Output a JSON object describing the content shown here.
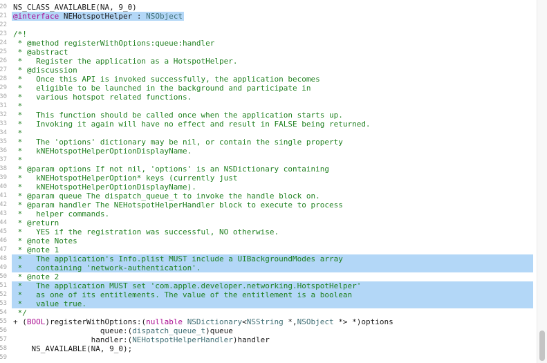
{
  "editor": {
    "lines": [
      {
        "n": "20",
        "hl": "",
        "segs": [
          [
            "pl",
            "NS_CLASS_AVAILABLE(NA, 9_0)"
          ]
        ]
      },
      {
        "n": "21",
        "hl": "partial",
        "segs": [
          [
            "kw",
            "@interface"
          ],
          [
            "pl",
            " NEHotspotHelper : "
          ],
          [
            "ty",
            "NSObject"
          ]
        ]
      },
      {
        "n": "22",
        "hl": "",
        "segs": []
      },
      {
        "n": "23",
        "hl": "",
        "segs": [
          [
            "c",
            "/*!"
          ]
        ]
      },
      {
        "n": "24",
        "hl": "",
        "segs": [
          [
            "c",
            " * @method registerWithOptions:queue:handler"
          ]
        ]
      },
      {
        "n": "25",
        "hl": "",
        "segs": [
          [
            "c",
            " * @abstract"
          ]
        ]
      },
      {
        "n": "26",
        "hl": "",
        "segs": [
          [
            "c",
            " *   Register the application as a HotspotHelper."
          ]
        ]
      },
      {
        "n": "27",
        "hl": "",
        "segs": [
          [
            "c",
            " * @discussion"
          ]
        ]
      },
      {
        "n": "28",
        "hl": "",
        "segs": [
          [
            "c",
            " *   Once this API is invoked successfully, the application becomes"
          ]
        ]
      },
      {
        "n": "29",
        "hl": "",
        "segs": [
          [
            "c",
            " *   eligible to be launched in the background and participate in"
          ]
        ]
      },
      {
        "n": "30",
        "hl": "",
        "segs": [
          [
            "c",
            " *   various hotspot related functions."
          ]
        ]
      },
      {
        "n": "31",
        "hl": "",
        "segs": [
          [
            "c",
            " *"
          ]
        ]
      },
      {
        "n": "32",
        "hl": "",
        "segs": [
          [
            "c",
            " *   This function should be called once when the application starts up."
          ]
        ]
      },
      {
        "n": "33",
        "hl": "",
        "segs": [
          [
            "c",
            " *   Invoking it again will have no effect and result in FALSE being returned."
          ]
        ]
      },
      {
        "n": "34",
        "hl": "",
        "segs": [
          [
            "c",
            " *"
          ]
        ]
      },
      {
        "n": "35",
        "hl": "",
        "segs": [
          [
            "c",
            " *   The 'options' dictionary may be nil, or contain the single property"
          ]
        ]
      },
      {
        "n": "36",
        "hl": "",
        "segs": [
          [
            "c",
            " *   kNEHotspotHelperOptionDisplayName."
          ]
        ]
      },
      {
        "n": "37",
        "hl": "",
        "segs": [
          [
            "c",
            " *"
          ]
        ]
      },
      {
        "n": "38",
        "hl": "",
        "segs": [
          [
            "c",
            " * @param options If not nil, 'options' is an NSDictionary containing"
          ]
        ]
      },
      {
        "n": "39",
        "hl": "",
        "segs": [
          [
            "c",
            " *   kNEHotspotHelperOption* keys (currently just"
          ]
        ]
      },
      {
        "n": "40",
        "hl": "",
        "segs": [
          [
            "c",
            " *   kNEHotspotHelperOptionDisplayName)."
          ]
        ]
      },
      {
        "n": "41",
        "hl": "",
        "segs": [
          [
            "c",
            " * @param queue The dispatch_queue_t to invoke the handle block on."
          ]
        ]
      },
      {
        "n": "42",
        "hl": "",
        "segs": [
          [
            "c",
            " * @param handler The NEHotspotHelperHandler block to execute to process"
          ]
        ]
      },
      {
        "n": "43",
        "hl": "",
        "segs": [
          [
            "c",
            " *   helper commands."
          ]
        ]
      },
      {
        "n": "44",
        "hl": "",
        "segs": [
          [
            "c",
            " * @return"
          ]
        ]
      },
      {
        "n": "45",
        "hl": "",
        "segs": [
          [
            "c",
            " *   YES if the registration was successful, NO otherwise."
          ]
        ]
      },
      {
        "n": "46",
        "hl": "",
        "segs": [
          [
            "c",
            " * @note Notes"
          ]
        ]
      },
      {
        "n": "47",
        "hl": "",
        "segs": [
          [
            "c",
            " * @note 1"
          ]
        ]
      },
      {
        "n": "48",
        "hl": "full",
        "segs": [
          [
            "c",
            " *   The application's Info.plist MUST include a UIBackgroundModes array"
          ]
        ]
      },
      {
        "n": "49",
        "hl": "full",
        "segs": [
          [
            "c",
            " *   containing 'network-authentication'."
          ]
        ]
      },
      {
        "n": "50",
        "hl": "",
        "segs": [
          [
            "c",
            " * @note 2"
          ]
        ]
      },
      {
        "n": "51",
        "hl": "full",
        "segs": [
          [
            "c",
            " *   The application MUST set 'com.apple.developer.networking.HotspotHelper'"
          ]
        ]
      },
      {
        "n": "52",
        "hl": "full",
        "segs": [
          [
            "c",
            " *   as one of its entitlements. The value of the entitlement is a boolean"
          ]
        ]
      },
      {
        "n": "53",
        "hl": "full",
        "segs": [
          [
            "c",
            " *   value true."
          ]
        ]
      },
      {
        "n": "54",
        "hl": "",
        "segs": [
          [
            "c",
            " */"
          ]
        ]
      },
      {
        "n": "55",
        "hl": "",
        "segs": [
          [
            "pl",
            "+ ("
          ],
          [
            "kw",
            "BOOL"
          ],
          [
            "pl",
            ")registerWithOptions:("
          ],
          [
            "kw",
            "nullable"
          ],
          [
            "pl",
            " "
          ],
          [
            "ty",
            "NSDictionary"
          ],
          [
            "pl",
            "<"
          ],
          [
            "ty",
            "NSString"
          ],
          [
            "pl",
            " *,"
          ],
          [
            "ty",
            "NSObject"
          ],
          [
            "pl",
            " *> *)options"
          ]
        ]
      },
      {
        "n": "56",
        "hl": "",
        "segs": [
          [
            "pl",
            "                   queue:("
          ],
          [
            "ty",
            "dispatch_queue_t"
          ],
          [
            "pl",
            ")queue"
          ]
        ]
      },
      {
        "n": "57",
        "hl": "",
        "segs": [
          [
            "pl",
            "                 handler:("
          ],
          [
            "ty",
            "NEHotspotHelperHandler"
          ],
          [
            "pl",
            ")handler"
          ]
        ]
      },
      {
        "n": "58",
        "hl": "",
        "segs": [
          [
            "pl",
            "    NS_AVAILABLE(NA, 9_0);"
          ]
        ]
      },
      {
        "n": "59",
        "hl": "",
        "segs": []
      }
    ]
  }
}
